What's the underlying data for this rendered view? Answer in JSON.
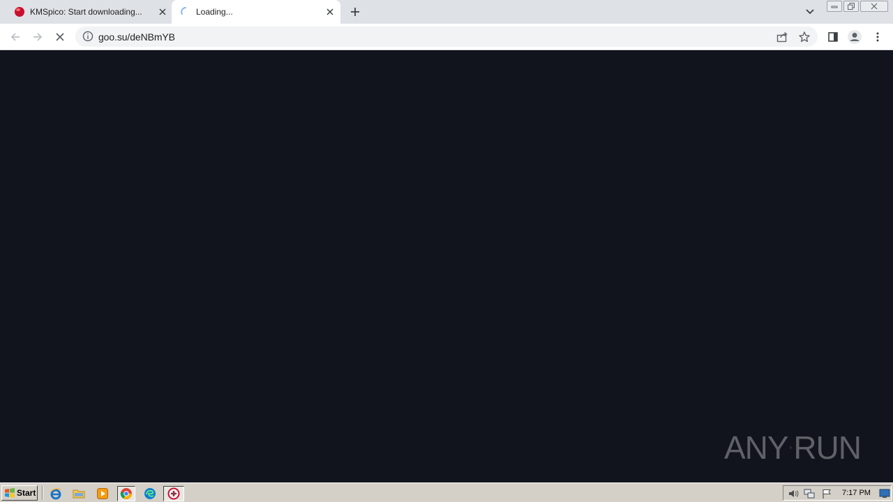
{
  "browser": {
    "tabs": [
      {
        "title": "KMSpico: Start downloading...",
        "favicon": "red-ball-icon",
        "active": false
      },
      {
        "title": "Loading...",
        "favicon": "loading-spinner-icon",
        "active": true
      }
    ],
    "address_bar": {
      "url": "goo.su/deNBmYB"
    }
  },
  "watermark": {
    "left": "ANY",
    "right": "RUN"
  },
  "taskbar": {
    "start_label": "Start",
    "quick_launch": [
      "internet-explorer-icon",
      "folder-icon",
      "media-player-icon",
      "chrome-icon",
      "edge-icon",
      "kmspico-icon"
    ],
    "tray_icons": [
      "volume-icon",
      "network-icon",
      "flag-icon"
    ],
    "clock": "7:17 PM"
  }
}
